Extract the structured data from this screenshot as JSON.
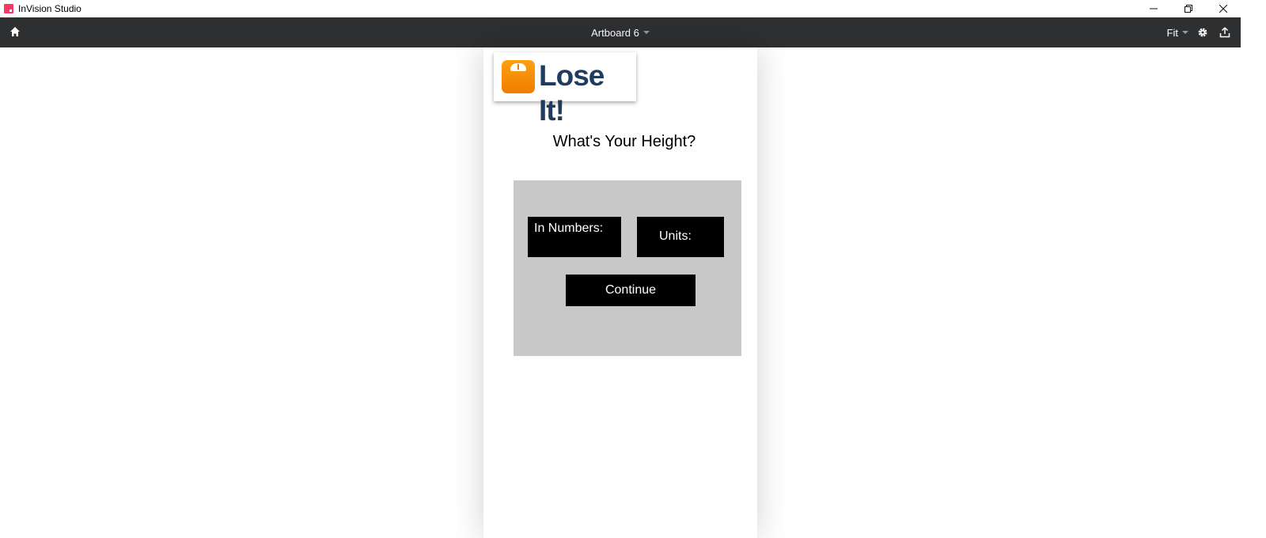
{
  "window": {
    "app_title": "InVision Studio",
    "controls": {
      "minimize": "—",
      "restore": "❐",
      "close": "✕"
    }
  },
  "toolbar": {
    "home_icon": "home-icon",
    "artboard_title": "Artboard 6",
    "zoom_label": "Fit",
    "settings_icon": "gear-icon",
    "share_icon": "upload-icon",
    "bg_color": "#2e2f31"
  },
  "artboard": {
    "logo_text": "Lose It!",
    "logo_color": "#1f3b5e",
    "logo_icon": "scale-icon",
    "heading": "What's Your Height?",
    "fields": {
      "numbers_label": "In Numbers:",
      "units_label": "Units:"
    },
    "continue_label": "Continue",
    "panel_color": "#c8c8c8"
  }
}
